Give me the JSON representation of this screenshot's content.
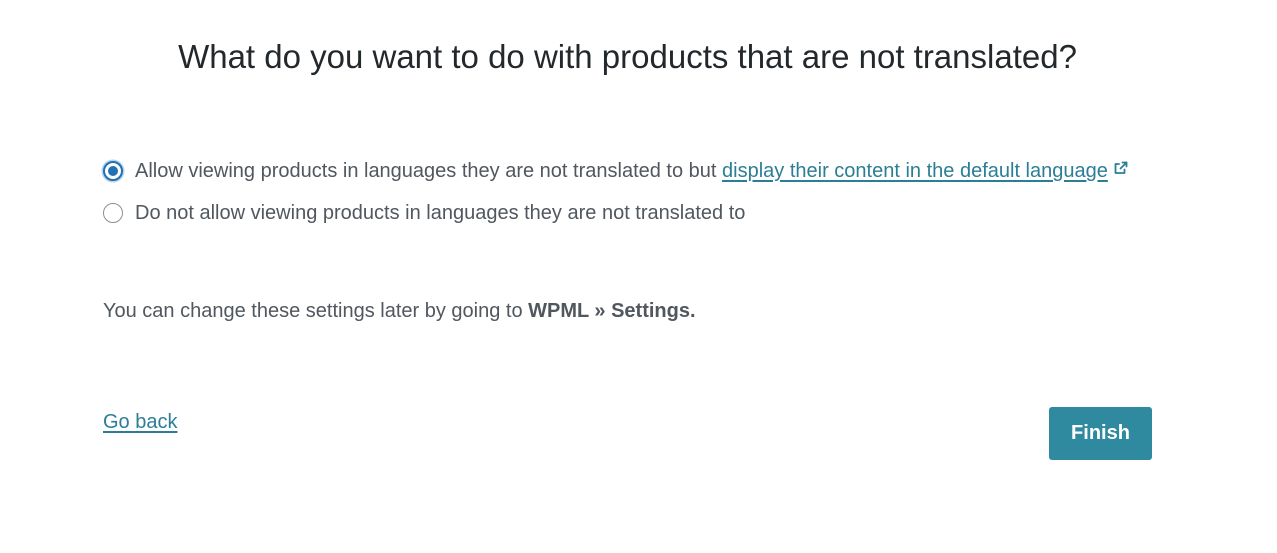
{
  "title": "What do you want to do with products that are not translated?",
  "options": [
    {
      "text_before": "Allow viewing products in languages they are not translated to but ",
      "link_text": "display their content in the default language",
      "link_icon": "external-link-icon",
      "selected": true
    },
    {
      "text": "Do not allow viewing products in languages they are not translated to",
      "selected": false
    }
  ],
  "note": {
    "text": "You can change these settings later by going to ",
    "strong": "WPML » Settings."
  },
  "footer": {
    "back_label": "Go back",
    "finish_label": "Finish"
  },
  "colors": {
    "accent": "#2271b1",
    "link": "#2b7e96",
    "button": "#2f8a9f"
  }
}
